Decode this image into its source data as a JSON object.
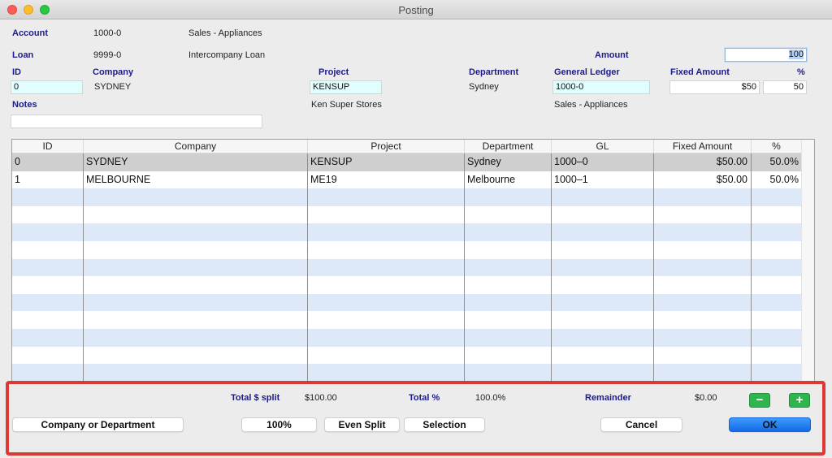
{
  "window": {
    "title": "Posting"
  },
  "header": {
    "account_label": "Account",
    "account_code": "1000-0",
    "account_name": "Sales - Appliances",
    "loan_label": "Loan",
    "loan_code": "9999-0",
    "loan_name": "Intercompany Loan",
    "amount_label": "Amount",
    "amount_value": "100"
  },
  "entry": {
    "id_label": "ID",
    "id_value": "0",
    "company_label": "Company",
    "company_value": "SYDNEY",
    "project_label": "Project",
    "project_value": "KENSUP",
    "project_name": "Ken Super Stores",
    "department_label": "Department",
    "department_value": "Sydney",
    "gl_label": "General Ledger",
    "gl_value": "1000-0",
    "gl_name": "Sales - Appliances",
    "fixed_amount_label": "Fixed Amount",
    "fixed_amount_value": "$50",
    "percent_label": "%",
    "percent_value": "50",
    "notes_label": "Notes",
    "notes_value": ""
  },
  "table": {
    "columns": [
      "ID",
      "Company",
      "Project",
      "Department",
      "GL",
      "Fixed Amount",
      "%"
    ],
    "rows": [
      {
        "id": "0",
        "company": "SYDNEY",
        "project": "KENSUP",
        "department": "Sydney",
        "gl": "1000–0",
        "fixed_amount": "$50.00",
        "percent": "50.0%",
        "selected": true
      },
      {
        "id": "1",
        "company": "MELBOURNE",
        "project": "ME19",
        "department": "Melbourne",
        "gl": "1000–1",
        "fixed_amount": "$50.00",
        "percent": "50.0%",
        "selected": false
      }
    ]
  },
  "footer": {
    "total_split_label": "Total $ split",
    "total_split_value": "$100.00",
    "total_percent_label": "Total %",
    "total_percent_value": "100.0%",
    "remainder_label": "Remainder",
    "remainder_value": "$0.00",
    "remove_icon": "minus-icon",
    "add_icon": "plus-icon",
    "buttons": {
      "company_or_department": "Company or Department",
      "hundred_percent": "100%",
      "even_split": "Even Split",
      "selection": "Selection",
      "cancel": "Cancel",
      "ok": "OK"
    }
  },
  "colors": {
    "label_blue": "#1c1c8c",
    "highlight_red": "#dd3a34",
    "ok_blue": "#1f78f0",
    "action_green": "#2fb44e",
    "row_stripe": "#dde8f9",
    "selected_row": "#cfcfcf"
  }
}
